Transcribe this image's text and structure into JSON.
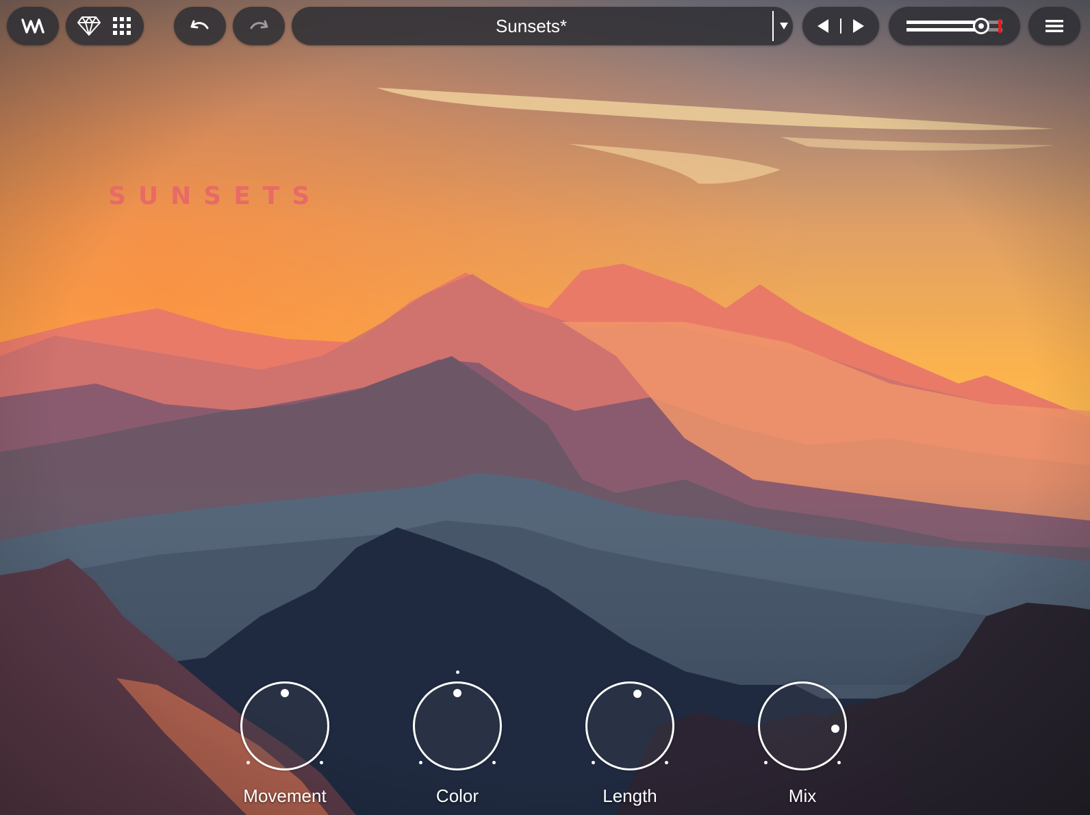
{
  "toolbar": {
    "logo_icon": "waves-logo-icon",
    "gem_icon": "diamond-icon",
    "apps_icon": "grid-icon",
    "undo_icon": "undo-icon",
    "redo_icon": "redo-icon",
    "preset_name": "Sunsets*",
    "preset_dropdown_icon": "triangle-down-icon",
    "prev_icon": "triangle-left-icon",
    "next_icon": "triangle-right-icon",
    "output_level": 0.78,
    "menu_icon": "hamburger-icon"
  },
  "brand": {
    "title": "SUNSETS"
  },
  "controls": {
    "knobs": [
      {
        "label": "Movement",
        "value": 0.5
      },
      {
        "label": "Color",
        "value": 0.5
      },
      {
        "label": "Length",
        "value": 0.55
      },
      {
        "label": "Mix",
        "value": 0.85
      }
    ]
  },
  "colors": {
    "accent_brand": "#e86a67",
    "meter_peak": "#e02020",
    "toolbar_bg": "#303036"
  }
}
